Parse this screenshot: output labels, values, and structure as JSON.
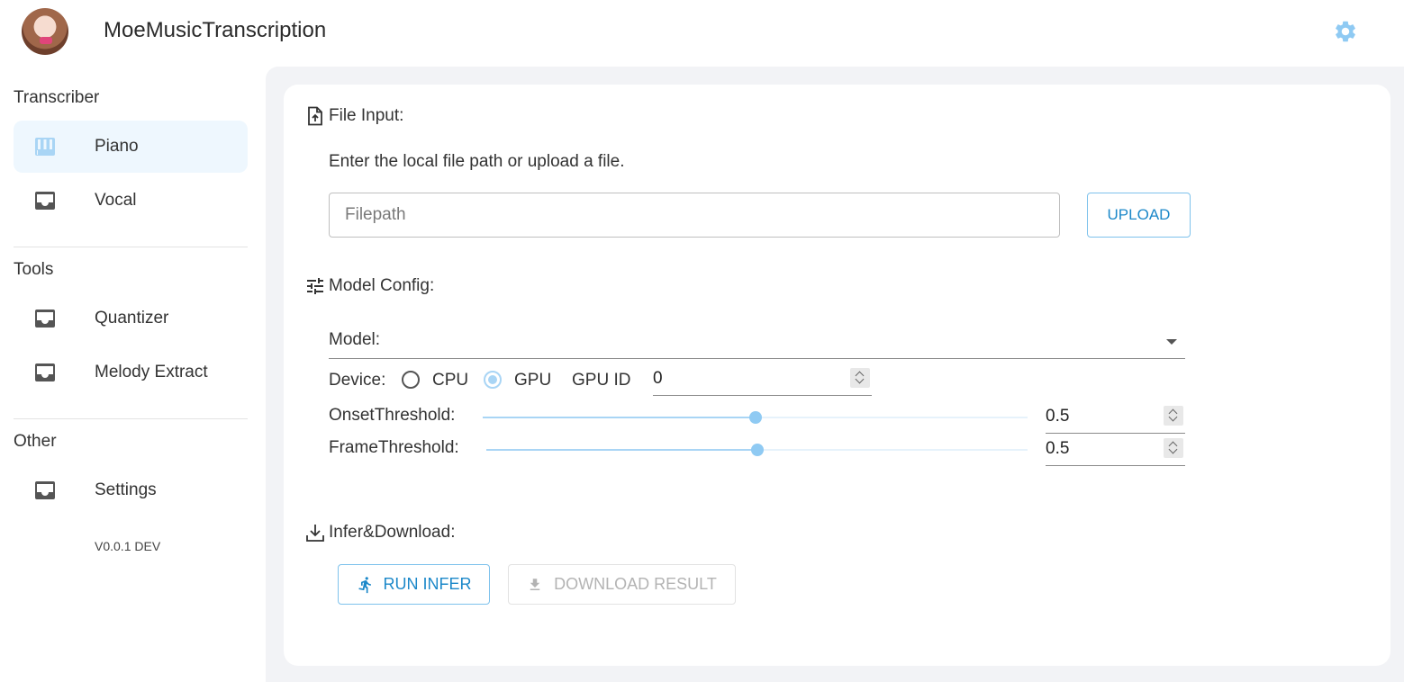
{
  "app": {
    "title": "MoeMusicTranscription"
  },
  "colors": {
    "accent": "#1c88c9",
    "accent_light": "#a9d5f5",
    "active_bg": "#eef7fe",
    "panel_bg": "#f2f3f6"
  },
  "header": {
    "settings_icon": "gear-icon"
  },
  "sidebar": {
    "sections": [
      {
        "title": "Transcriber",
        "items": [
          {
            "label": "Piano",
            "icon": "piano-icon",
            "active": true
          },
          {
            "label": "Vocal",
            "icon": "inbox-icon",
            "active": false
          }
        ]
      },
      {
        "title": "Tools",
        "items": [
          {
            "label": "Quantizer",
            "icon": "inbox-icon",
            "active": false
          },
          {
            "label": "Melody Extract",
            "icon": "inbox-icon",
            "active": false
          }
        ]
      },
      {
        "title": "Other",
        "items": [
          {
            "label": "Settings",
            "icon": "inbox-icon",
            "active": false
          }
        ]
      }
    ],
    "version": "V0.0.1 DEV"
  },
  "main": {
    "file_input": {
      "heading": "File Input:",
      "hint": "Enter the local file path or upload a file.",
      "path_placeholder": "Filepath",
      "path_value": "",
      "upload_label": "UPLOAD"
    },
    "model_config": {
      "heading": "Model Config:",
      "model_label": "Model:",
      "model_value": "",
      "device_label": "Device:",
      "device_options": [
        "CPU",
        "GPU"
      ],
      "device_selected": "GPU",
      "gpu_id_label": "GPU ID",
      "gpu_id_value": "0",
      "onset_label": "OnsetThreshold:",
      "onset_value": "0.5",
      "onset_fraction": 0.5,
      "frame_label": "FrameThreshold:",
      "frame_value": "0.5",
      "frame_fraction": 0.5
    },
    "infer": {
      "heading": "Infer&Download:",
      "run_label": "RUN INFER",
      "download_label": "DOWNLOAD RESULT"
    }
  }
}
